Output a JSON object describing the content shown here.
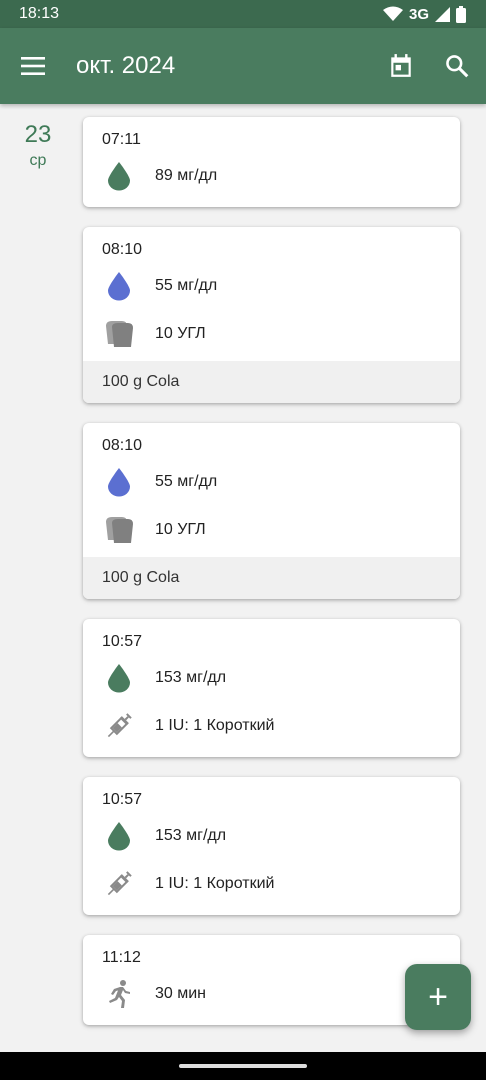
{
  "status": {
    "time": "18:13",
    "network": "3G"
  },
  "appbar": {
    "title": "окт. 2024"
  },
  "day": {
    "number": "23",
    "weekday": "ср"
  },
  "entries": [
    {
      "time": "07:11",
      "rows": [
        {
          "icon": "drop-green-icon",
          "value": "89 мг/дл"
        }
      ]
    },
    {
      "time": "08:10",
      "rows": [
        {
          "icon": "drop-blue-icon",
          "value": "55 мг/дл"
        },
        {
          "icon": "bread-icon",
          "value": "10 УГЛ"
        }
      ],
      "note": "100 g Cola"
    },
    {
      "time": "08:10",
      "rows": [
        {
          "icon": "drop-blue-icon",
          "value": "55 мг/дл"
        },
        {
          "icon": "bread-icon",
          "value": "10 УГЛ"
        }
      ],
      "note": "100 g Cola"
    },
    {
      "time": "10:57",
      "rows": [
        {
          "icon": "drop-green-icon",
          "value": "153 мг/дл"
        },
        {
          "icon": "syringe-icon",
          "value": "1 IU: 1 Короткий"
        }
      ]
    },
    {
      "time": "10:57",
      "rows": [
        {
          "icon": "drop-green-icon",
          "value": "153 мг/дл"
        },
        {
          "icon": "syringe-icon",
          "value": "1 IU: 1 Короткий"
        }
      ]
    },
    {
      "time": "11:12",
      "rows": [
        {
          "icon": "running-icon",
          "value": "30 мин"
        }
      ]
    }
  ],
  "fab": {
    "label": "+"
  },
  "colors": {
    "primary": "#4a7c5f",
    "status_bar": "#3c6a4f",
    "drop_green": "#4a7c5f",
    "drop_blue": "#5b6fd1",
    "icon_gray": "#8a8a8a"
  }
}
